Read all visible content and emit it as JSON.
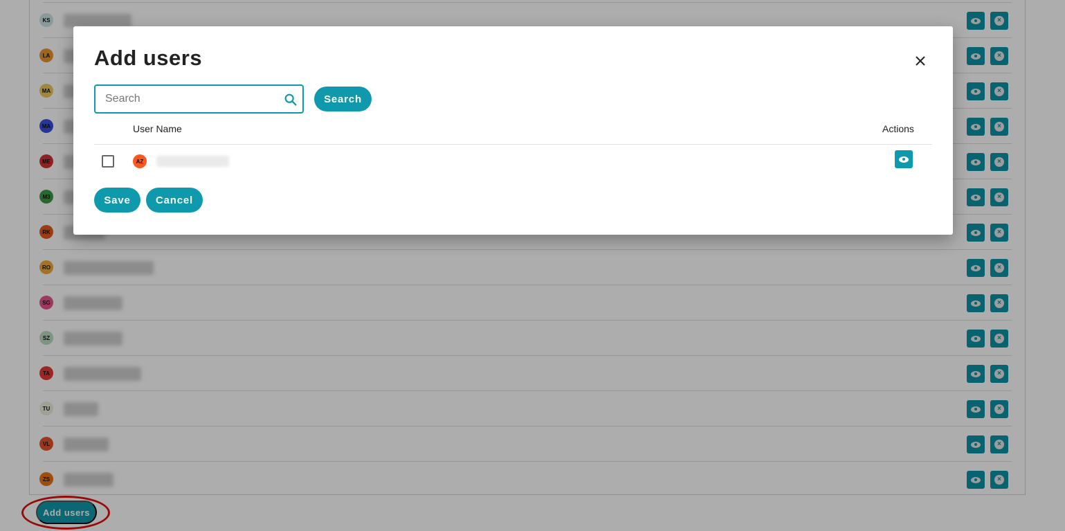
{
  "background": {
    "rows": [
      {
        "initials": "KS",
        "avatar_color": "#c9e3e6",
        "name_visible": ""
      },
      {
        "initials": "LA",
        "avatar_color": "#e8962c",
        "name_visible": "la"
      },
      {
        "initials": "MA",
        "avatar_color": "#e8c95c",
        "name_visible": "m"
      },
      {
        "initials": "MA",
        "avatar_color": "#3b4fe0",
        "name_visible": "M"
      },
      {
        "initials": "ME",
        "avatar_color": "#d03434",
        "name_visible": "M"
      },
      {
        "initials": "M3",
        "avatar_color": "#3a9a44",
        "name_visible": "m"
      },
      {
        "initials": "RK",
        "avatar_color": "#e35a1e",
        "name_visible": "R"
      },
      {
        "initials": "RO",
        "avatar_color": "#eeaa33",
        "name_visible": ""
      },
      {
        "initials": "SG",
        "avatar_color": "#e65590",
        "name_visible": ""
      },
      {
        "initials": "SZ",
        "avatar_color": "#b7dcbd",
        "name_visible": ""
      },
      {
        "initials": "TA",
        "avatar_color": "#e53935",
        "name_visible": ""
      },
      {
        "initials": "TU",
        "avatar_color": "#ececdc",
        "name_visible": ""
      },
      {
        "initials": "VL",
        "avatar_color": "#e5532a",
        "name_visible": ""
      },
      {
        "initials": "ZS",
        "avatar_color": "#e6740f",
        "name_visible": ""
      }
    ],
    "add_users_label": "Add users"
  },
  "modal": {
    "title": "Add users",
    "search_placeholder": "Search",
    "search_value": "",
    "search_button": "Search",
    "columns": {
      "user_name": "User Name",
      "actions": "Actions"
    },
    "rows": [
      {
        "initials": "AZ",
        "avatar_color": "#ff5722",
        "checked": false
      }
    ],
    "save_label": "Save",
    "cancel_label": "Cancel"
  },
  "colors": {
    "accent": "#0e9aac",
    "annotation": "#e01010"
  }
}
